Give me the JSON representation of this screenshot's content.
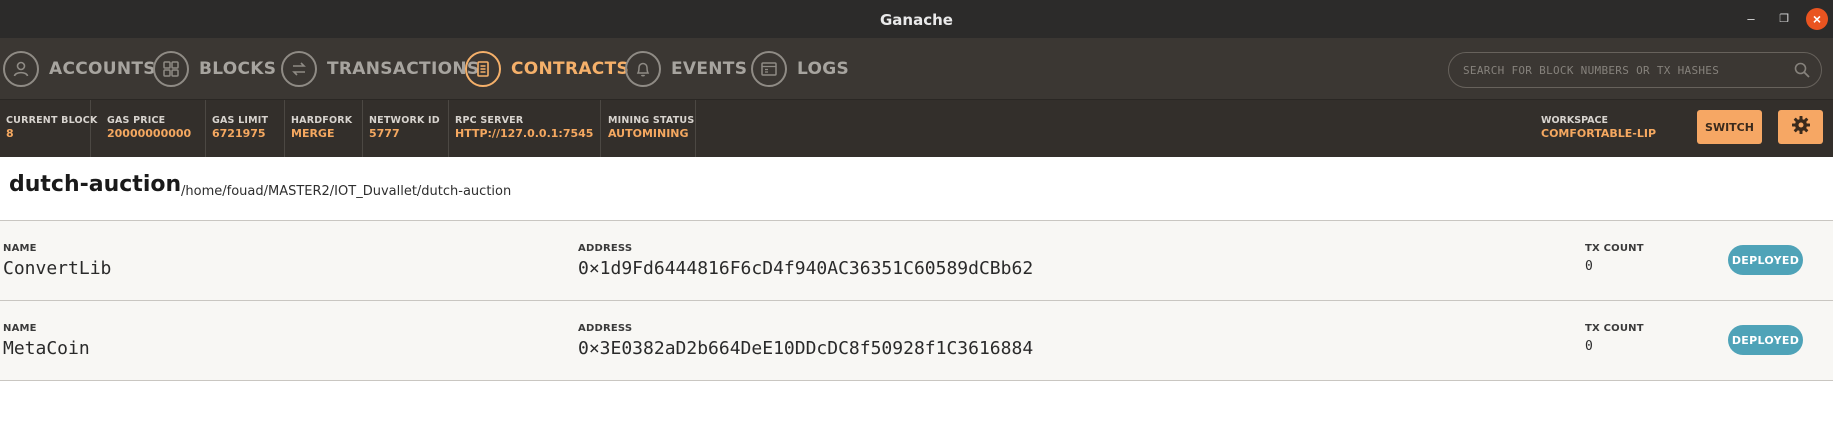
{
  "window": {
    "title": "Ganache"
  },
  "nav": {
    "items": [
      {
        "label": "ACCOUNTS",
        "icon": "user-icon",
        "active": false
      },
      {
        "label": "BLOCKS",
        "icon": "blocks-icon",
        "active": false
      },
      {
        "label": "TRANSACTIONS",
        "icon": "transfer-icon",
        "active": false
      },
      {
        "label": "CONTRACTS",
        "icon": "document-icon",
        "active": true
      },
      {
        "label": "EVENTS",
        "icon": "bell-icon",
        "active": false
      },
      {
        "label": "LOGS",
        "icon": "terminal-icon",
        "active": false
      }
    ],
    "search_placeholder": "SEARCH FOR BLOCK NUMBERS OR TX HASHES"
  },
  "status": {
    "current_block": {
      "label": "CURRENT BLOCK",
      "value": "8"
    },
    "gas_price": {
      "label": "GAS PRICE",
      "value": "20000000000"
    },
    "gas_limit": {
      "label": "GAS LIMIT",
      "value": "6721975"
    },
    "hardfork": {
      "label": "HARDFORK",
      "value": "MERGE"
    },
    "network_id": {
      "label": "NETWORK ID",
      "value": "5777"
    },
    "rpc_server": {
      "label": "RPC SERVER",
      "value": "HTTP://127.0.0.1:7545"
    },
    "mining_status": {
      "label": "MINING STATUS",
      "value": "AUTOMINING"
    },
    "workspace": {
      "label": "WORKSPACE",
      "value": "COMFORTABLE-LIP"
    },
    "switch_label": "SWITCH"
  },
  "project": {
    "name": "dutch-auction",
    "path": "/home/fouad/MASTER2/IOT_Duvallet/dutch-auction"
  },
  "contracts": [
    {
      "name_label": "NAME",
      "name": "ConvertLib",
      "address_label": "ADDRESS",
      "address": "0×1d9Fd6444816F6cD4f940AC36351C60589dCBb62",
      "tx_label": "TX COUNT",
      "tx_count": "0",
      "status": "DEPLOYED"
    },
    {
      "name_label": "NAME",
      "name": "MetaCoin",
      "address_label": "ADDRESS",
      "address": "0×3E0382aD2b664DeE10DDcDC8f50928f1C3616884",
      "tx_label": "TX COUNT",
      "tx_count": "0",
      "status": "DEPLOYED"
    }
  ],
  "colors": {
    "accent": "#f5a860",
    "badge": "#4fa3b8",
    "nav_bg": "#3b3733",
    "status_bg": "#332f2b"
  }
}
